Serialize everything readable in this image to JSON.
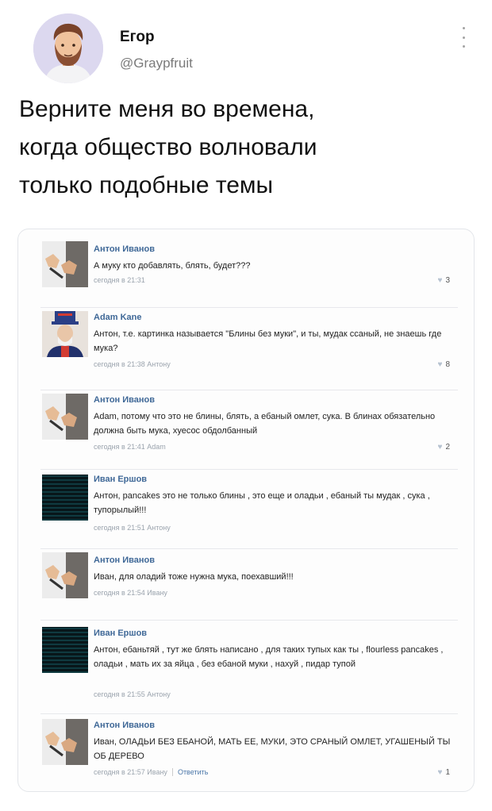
{
  "tweet": {
    "author_name": "Егор",
    "author_handle": "@Graypfruit",
    "text": "Верните меня во времена,\nкогда общество волновали\nтолько подобные темы"
  },
  "comments": [
    {
      "author": "Антон Иванов",
      "avatar": "hands-avatar",
      "text": "А муку кто добавлять, блять, будет???",
      "meta": "сегодня в 21:31",
      "reply": "",
      "likes": "3"
    },
    {
      "author": "Adam Kane",
      "avatar": "uncle-sam-avatar",
      "text": "Антон, т.е. картинка называется \"Блины без муки\", и ты, мудак ссаный, не знаешь где мука?",
      "meta": "сегодня в 21:38 Антону",
      "reply": "",
      "likes": "8"
    },
    {
      "author": "Антон Иванов",
      "avatar": "hands-avatar",
      "text": "Adam, потому что это не блины, блять, а ебаный омлет, сука. В блинах обязательно должна быть мука, хуесос обдолбанный",
      "meta": "сегодня в 21:41 Adam",
      "reply": "",
      "likes": "2"
    },
    {
      "author": "Иван Ершов",
      "avatar": "matrix-avatar",
      "text": "Антон, pancakes это не только блины , это еще и оладьи , ебаный ты мудак , сука , тупорылый!!!",
      "meta": "сегодня в 21:51 Антону",
      "reply": "",
      "likes": ""
    },
    {
      "author": "Антон Иванов",
      "avatar": "hands-avatar",
      "text": "Иван, для оладий тоже нужна мука, поехавший!!!",
      "meta": "сегодня в 21:54 Ивану",
      "reply": "",
      "likes": ""
    },
    {
      "author": "Иван Ершов",
      "avatar": "matrix-avatar",
      "text": "Антон, ебаньтяй , тут же блять написано , для таких тупых как ты , flourless pancakes , оладьи , мать их за яйца , без ебаной муки , нахуй , пидар тупой",
      "meta": "сегодня в 21:55 Антону",
      "reply": "",
      "likes": ""
    },
    {
      "author": "Антон Иванов",
      "avatar": "hands-avatar",
      "text": "Иван, ОЛАДЬИ БЕЗ ЕБАНОЙ, МАТЬ ЕЕ, МУКИ, ЭТО СРАНЫЙ ОМЛЕТ, УГАШЕНЫЙ ТЫ ОБ ДЕРЕВО",
      "meta": "сегодня в 21:57 Ивану",
      "reply": "Ответить",
      "likes": "1"
    }
  ]
}
